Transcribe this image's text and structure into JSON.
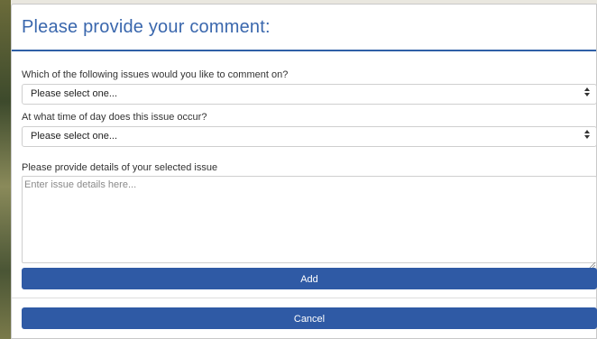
{
  "modal": {
    "title": "Please provide your comment:"
  },
  "issue_field": {
    "label": "Which of the following issues would you like to comment on?",
    "selected": "Please select one..."
  },
  "time_field": {
    "label": "At what time of day does this issue occur?",
    "selected": "Please select one..."
  },
  "details_field": {
    "label": "Please provide details of your selected issue",
    "placeholder": "Enter issue details here...",
    "value": ""
  },
  "buttons": {
    "add_label": "Add",
    "cancel_label": "Cancel"
  },
  "colors": {
    "accent": "#2f5aa5",
    "title": "#3a67ad"
  },
  "icons": {
    "select_arrows": "sort-arrows-icon",
    "resize": "resize-grip-icon"
  }
}
